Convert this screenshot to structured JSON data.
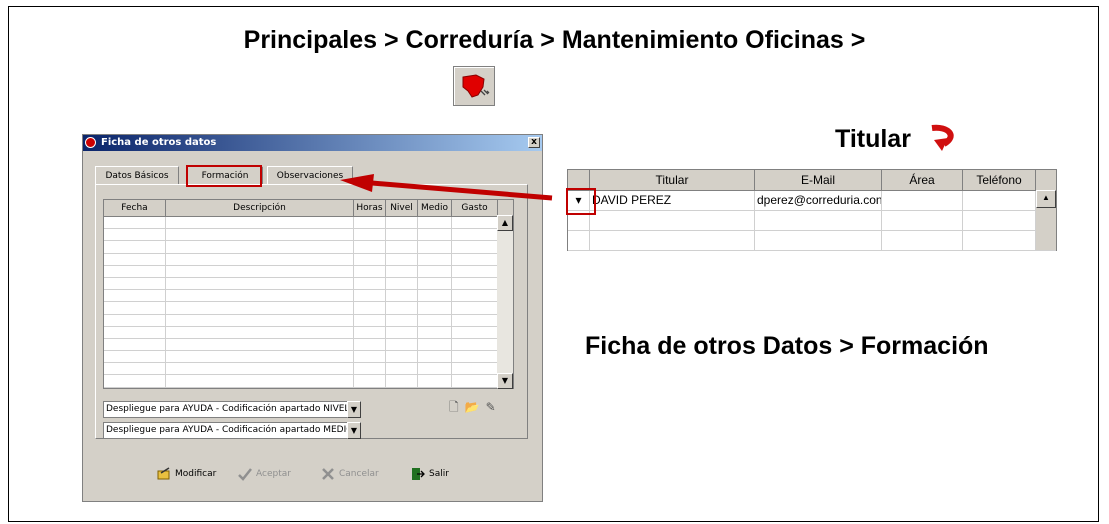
{
  "breadcrumb": "Principales > Correduría  > Mantenimiento Oficinas >",
  "titular_label": "Titular",
  "section_label": "Ficha de otros Datos > Formación",
  "dialog": {
    "title": "Ficha de otros datos",
    "close": "x",
    "tabs": [
      "Datos Básicos",
      "Formación",
      "Observaciones"
    ],
    "active_tab": "Formación",
    "grid_columns": [
      "Fecha",
      "Descripción",
      "Horas",
      "Nivel",
      "Medio",
      "Gasto"
    ],
    "combo_nivel": "Despliegue para AYUDA - Codificación apartado NIVEL",
    "combo_medio": "Despliegue para AYUDA - Codificación apartado MEDIO",
    "buttons": {
      "modificar": "Modificar",
      "aceptar": "Aceptar",
      "cancelar": "Cancelar",
      "salir": "Salir"
    }
  },
  "titular_grid": {
    "columns": [
      "Titular",
      "E-Mail",
      "Área",
      "Teléfono"
    ],
    "rows": [
      {
        "titular": "DAVID PEREZ",
        "email": "dperez@correduria.con",
        "area": "",
        "telefono": ""
      }
    ]
  },
  "colors": {
    "highlight": "#c00000",
    "dialog_title_start": "#0a246a",
    "window_face": "#d4d0c8"
  }
}
